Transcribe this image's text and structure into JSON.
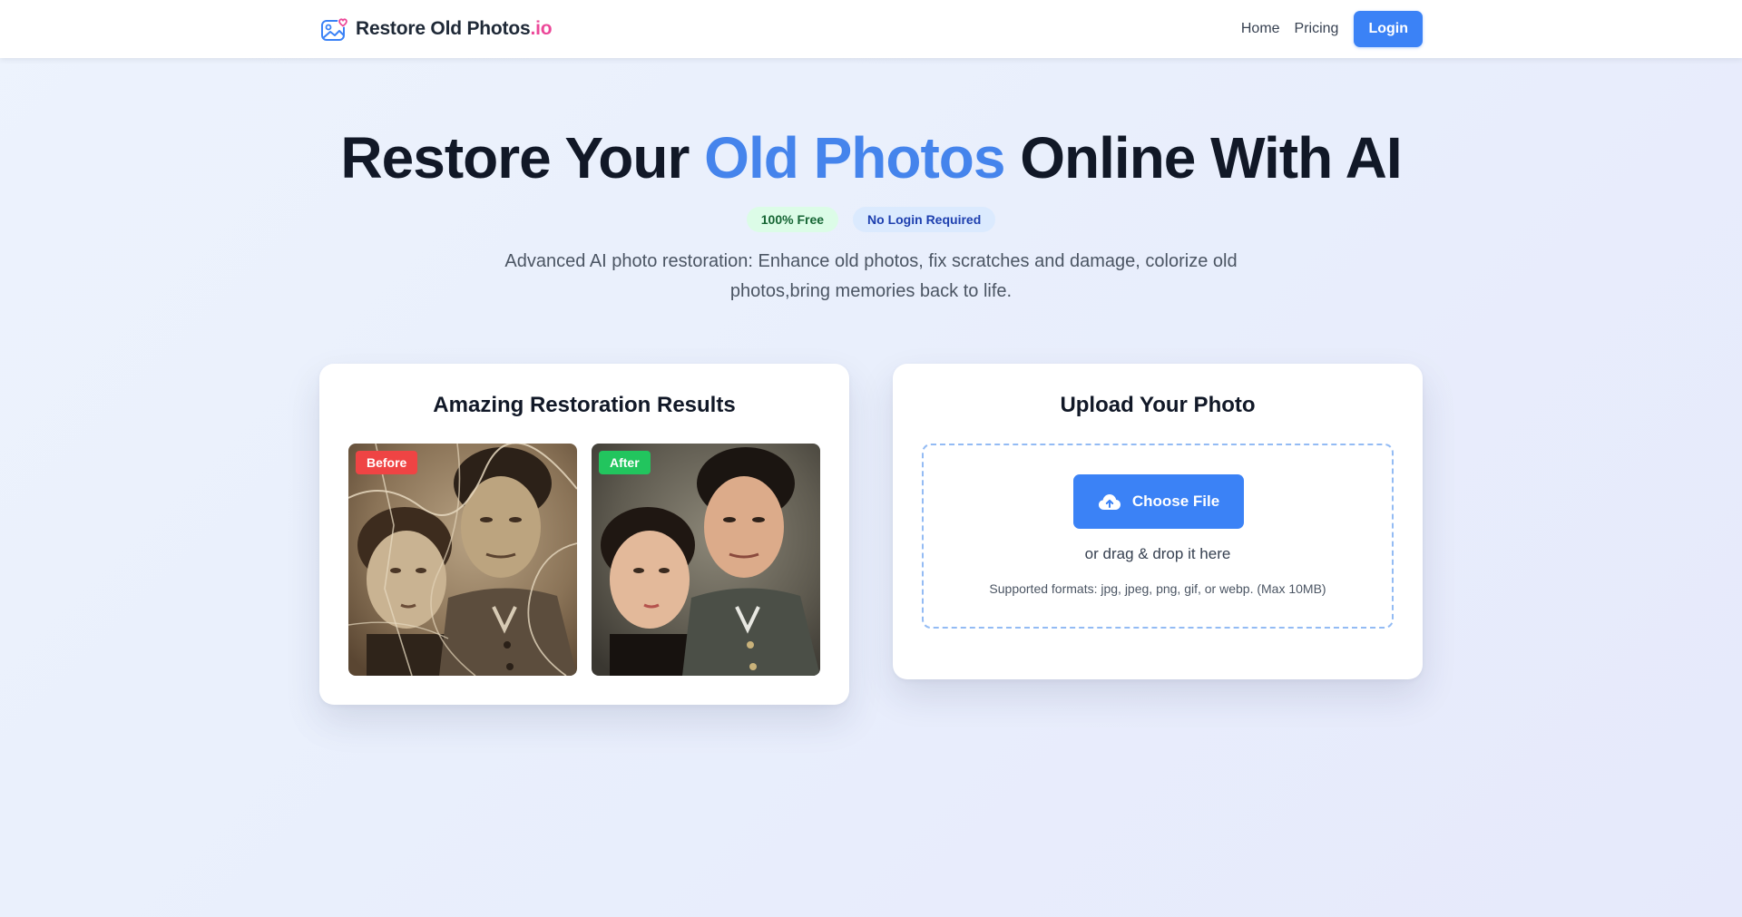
{
  "header": {
    "brand_name": "Restore Old Photos",
    "brand_suffix": ".io",
    "nav": [
      {
        "label": "Home"
      },
      {
        "label": "Pricing"
      }
    ],
    "login_label": "Login"
  },
  "hero": {
    "title_part1": "Restore Your ",
    "title_accent": "Old Photos",
    "title_part2": " Online With AI",
    "badges": [
      "100% Free",
      "No Login Required"
    ],
    "subtitle": "Advanced AI photo restoration: Enhance old photos, fix scratches and damage, colorize old photos,bring memories back to life."
  },
  "results": {
    "title": "Amazing Restoration Results",
    "before_label": "Before",
    "after_label": "After"
  },
  "upload": {
    "title": "Upload Your Photo",
    "button_label": "Choose File",
    "drag_text": "or drag & drop it here",
    "formats_text": "Supported formats: jpg, jpeg, png, gif, or webp. (Max 10MB)"
  },
  "colors": {
    "accent": "#3b82f6",
    "title_accent": "#4584ec",
    "brand_suffix": "#ec4899",
    "before_tag": "#ef4444",
    "after_tag": "#22c55e"
  },
  "icons": [
    "photo-heart-logo-icon",
    "cloud-upload-icon"
  ]
}
